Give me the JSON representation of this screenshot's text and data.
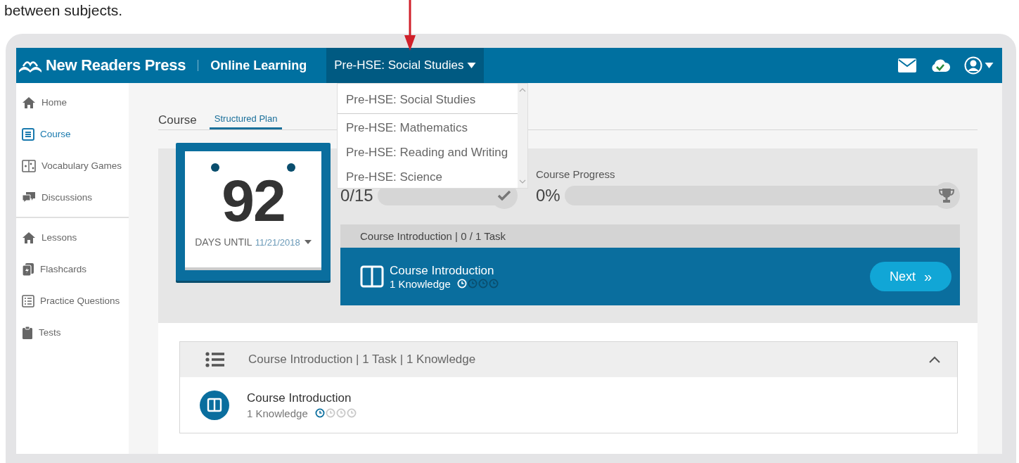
{
  "caption": "between subjects.",
  "header": {
    "brand": "New Readers Press",
    "product": "Online Learning",
    "subject": "Pre-HSE: Social Studies"
  },
  "subject_menu": [
    {
      "label": "Pre-HSE: Social Studies",
      "selected": true
    },
    {
      "label": "Pre-HSE: Mathematics",
      "selected": false
    },
    {
      "label": "Pre-HSE: Reading and Writing",
      "selected": false
    },
    {
      "label": "Pre-HSE: Science",
      "selected": false
    }
  ],
  "sidebar": {
    "groups": [
      [
        {
          "label": "Home",
          "kind": "home",
          "selected": false
        },
        {
          "label": "Course",
          "kind": "course",
          "selected": true
        },
        {
          "label": "Vocabulary Games",
          "kind": "games",
          "selected": false
        },
        {
          "label": "Discussions",
          "kind": "chat",
          "selected": false
        }
      ],
      [
        {
          "label": "Lessons",
          "kind": "home",
          "selected": false
        },
        {
          "label": "Flashcards",
          "kind": "cards",
          "selected": false
        },
        {
          "label": "Practice Questions",
          "kind": "list",
          "selected": false
        },
        {
          "label": "Tests",
          "kind": "clipboard",
          "selected": false
        }
      ]
    ]
  },
  "tabs": [
    {
      "label": "Course",
      "selected": false
    },
    {
      "label": "Structured Plan",
      "selected": true
    }
  ],
  "countdown": {
    "days": "92",
    "label": "DAYS UNTIL",
    "date": "11/21/2018"
  },
  "task_progress": {
    "count": "0/15",
    "level": 0
  },
  "course_progress": {
    "label": "Course Progress",
    "value": "0%",
    "level": 0
  },
  "current_task": {
    "header": "Course Introduction | 0 / 1 Task",
    "title": "Course Introduction",
    "meta": "1 Knowledge",
    "clocks": [
      {
        "done": true
      },
      {
        "done": false
      },
      {
        "done": false
      },
      {
        "done": false
      }
    ],
    "button": "Next",
    "button_icon": "»"
  },
  "section": {
    "title": "Course Introduction | 1 Task | 1 Knowledge",
    "expanded": true,
    "items": [
      {
        "title": "Course Introduction",
        "meta": "1 Knowledge",
        "clocks": [
          {
            "done": true
          },
          {
            "done": false
          },
          {
            "done": false
          },
          {
            "done": false
          }
        ]
      }
    ]
  }
}
